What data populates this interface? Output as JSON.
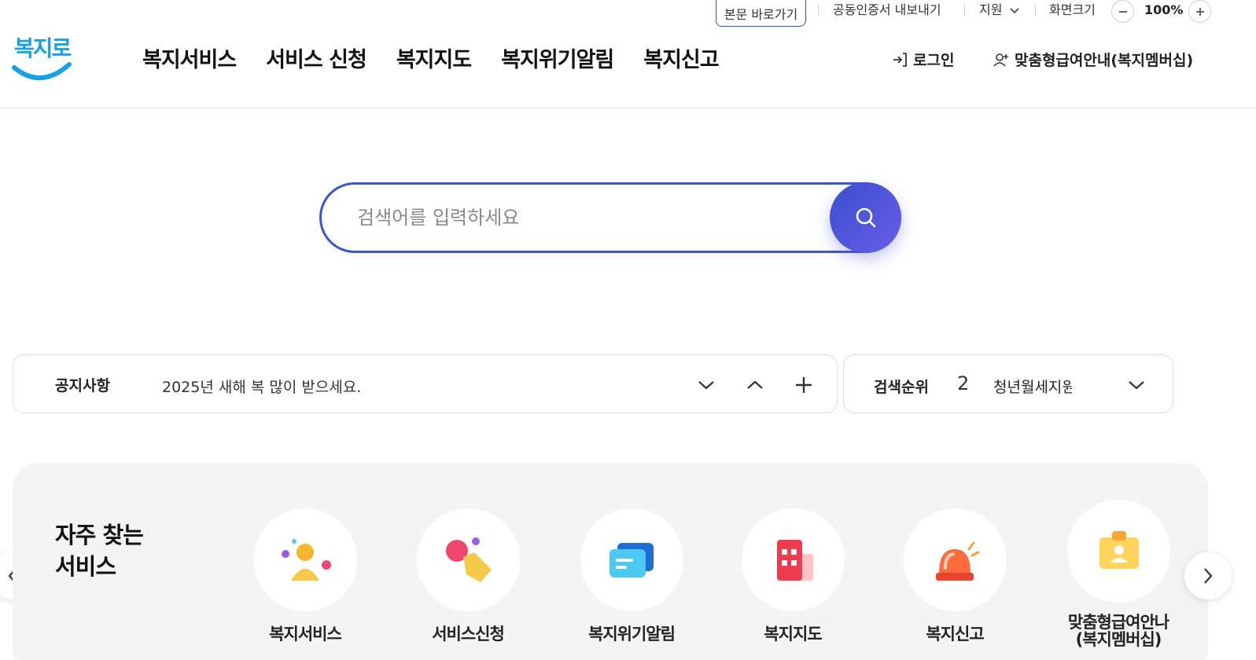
{
  "utility": {
    "skip_link": "본문 바로가기",
    "cert_export": "공동인증서 내보내기",
    "support": "지원",
    "screen_size": "화면크기",
    "zoom_value": "100%"
  },
  "header": {
    "logo_text": "복지로",
    "nav": [
      "복지서비스",
      "서비스 신청",
      "복지지도",
      "복지위기알림",
      "복지신고"
    ],
    "login": "로그인",
    "membership": "맞춤형급여안내(복지멤버십)"
  },
  "search": {
    "placeholder": "검색어를 입력하세요"
  },
  "notice": {
    "title": "공지사항",
    "text": "2025년 새해 복 많이 받으세요."
  },
  "rank": {
    "title": "검색순위",
    "number": "2",
    "term": "청년월세지원"
  },
  "frequent": {
    "title_line1": "자주 찾는",
    "title_line2": "서비스",
    "items": [
      {
        "label": "복지서비스",
        "icon": "person-icon"
      },
      {
        "label": "서비스신청",
        "icon": "hand-tap-icon"
      },
      {
        "label": "복지위기알림",
        "icon": "message-icon"
      },
      {
        "label": "복지지도",
        "icon": "building-icon"
      },
      {
        "label": "복지신고",
        "icon": "siren-icon"
      },
      {
        "label_line1": "맞춤형급여안나",
        "label_line2": "(복지멤버십)",
        "icon": "id-card-icon"
      }
    ]
  },
  "colors": {
    "brand_blue": "#3a55d4",
    "search_button": "#4b55dc",
    "panel_bg": "#f4f4f4"
  }
}
